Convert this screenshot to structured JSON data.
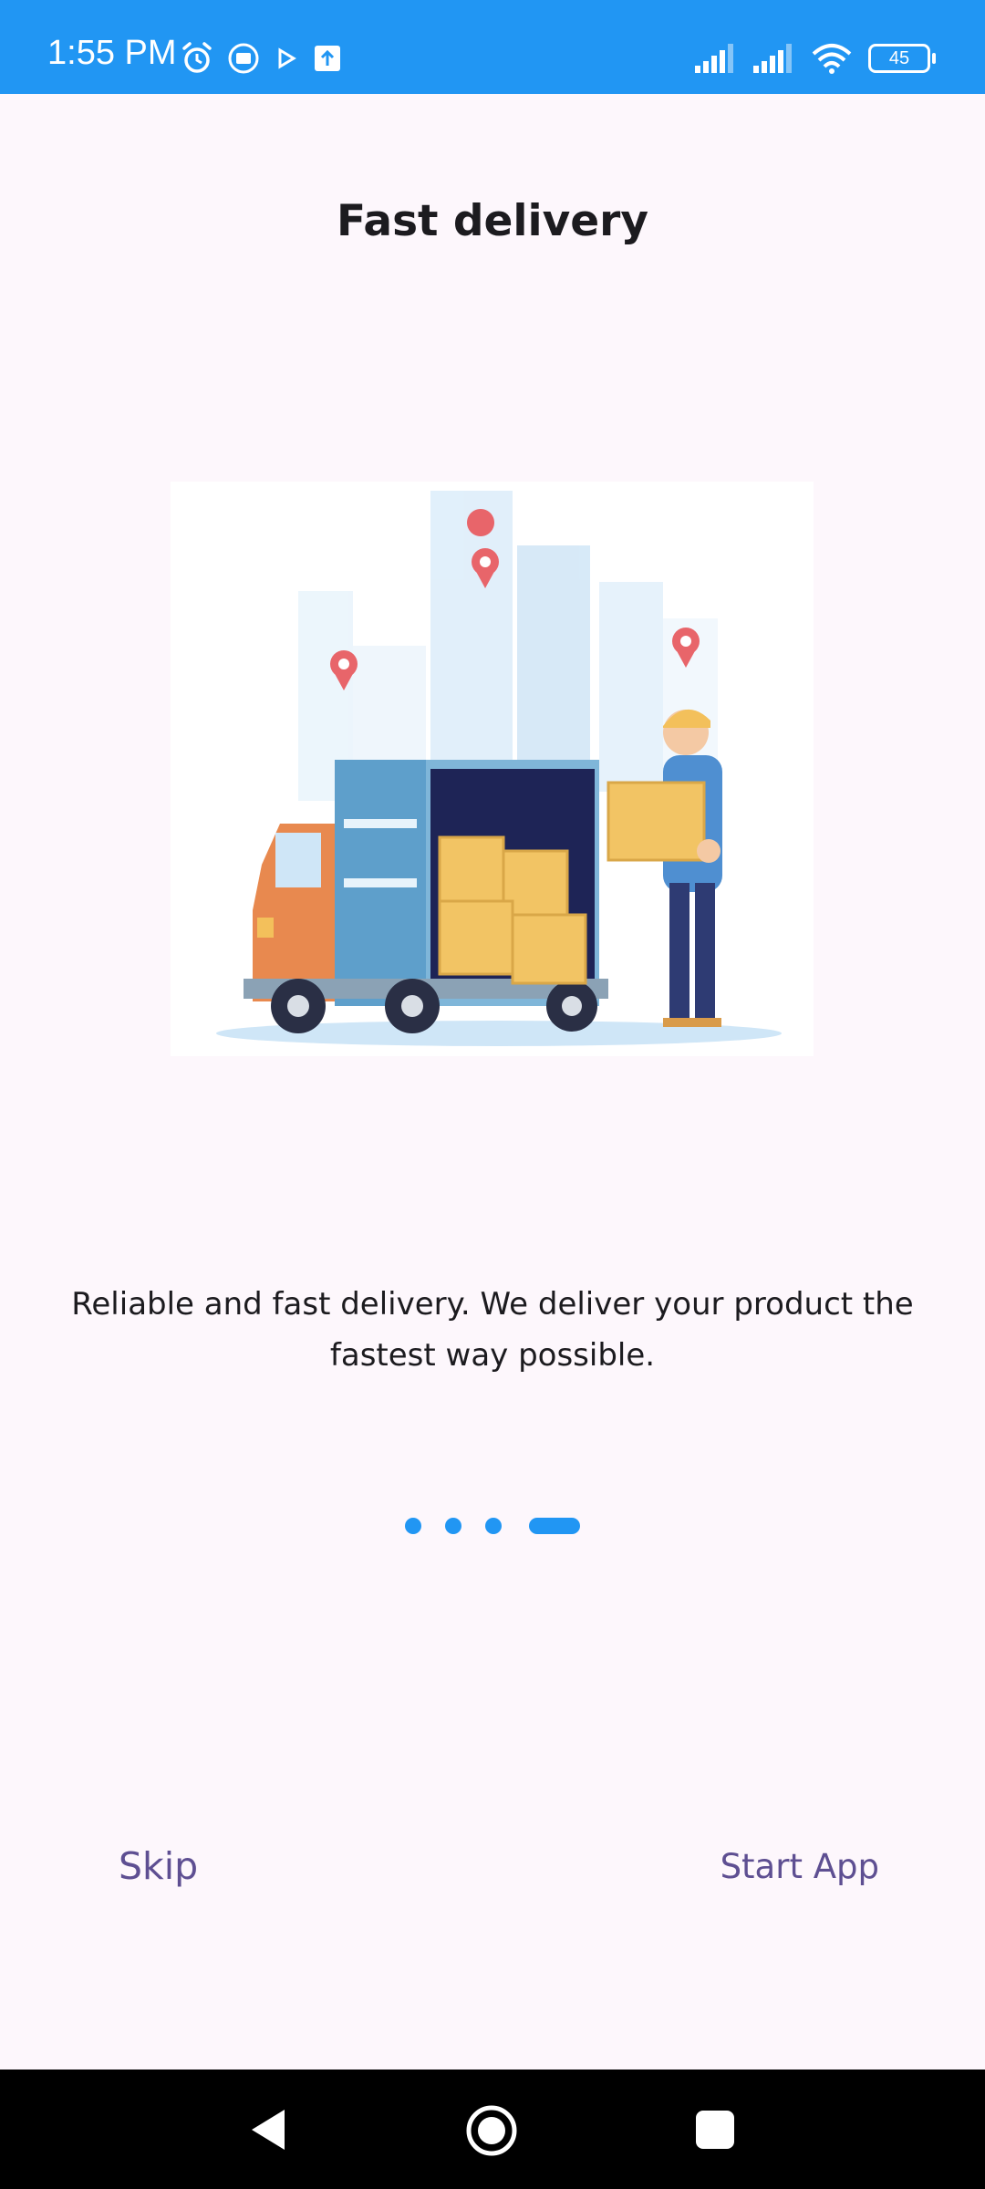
{
  "status_bar": {
    "time": "1:55 PM",
    "battery": "45",
    "icons_left": [
      "alarm-icon",
      "screen-record-icon",
      "play-store-icon",
      "upload-icon"
    ],
    "icons_right": [
      "signal-icon",
      "signal-icon",
      "wifi-icon",
      "battery-icon"
    ]
  },
  "onboarding": {
    "title": "Fast delivery",
    "description": "Reliable and fast delivery. We deliver your product the fastest way possible.",
    "page_indicator": {
      "total": 4,
      "current": 4
    },
    "skip_label": "Skip",
    "start_label": "Start App"
  },
  "colors": {
    "primary": "#2196F3",
    "background": "#FDF7FC",
    "button_text": "#5E4F92"
  },
  "nav_bar": {
    "buttons": [
      "back-icon",
      "home-icon",
      "recents-icon"
    ]
  }
}
